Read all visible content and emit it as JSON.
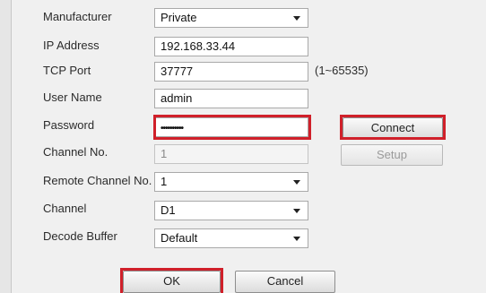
{
  "form": {
    "manufacturer": {
      "label": "Manufacturer",
      "value": "Private"
    },
    "ip_address": {
      "label": "IP Address",
      "value": "192.168.33.44"
    },
    "tcp_port": {
      "label": "TCP Port",
      "value": "37777",
      "hint": "(1~65535)"
    },
    "user_name": {
      "label": "User Name",
      "value": "admin"
    },
    "password": {
      "label": "Password",
      "value": "••••••••••"
    },
    "channel_no": {
      "label": "Channel No.",
      "value": "1"
    },
    "remote_channel_no": {
      "label": "Remote Channel No.",
      "value": "1"
    },
    "channel": {
      "label": "Channel",
      "value": "D1"
    },
    "decode_buffer": {
      "label": "Decode Buffer",
      "value": "Default"
    }
  },
  "buttons": {
    "connect": "Connect",
    "setup": "Setup",
    "ok": "OK",
    "cancel": "Cancel"
  },
  "colors": {
    "highlight": "#d0202a",
    "background": "#f0f0f0"
  },
  "icons": {
    "dropdown": "chevron-down-icon"
  }
}
